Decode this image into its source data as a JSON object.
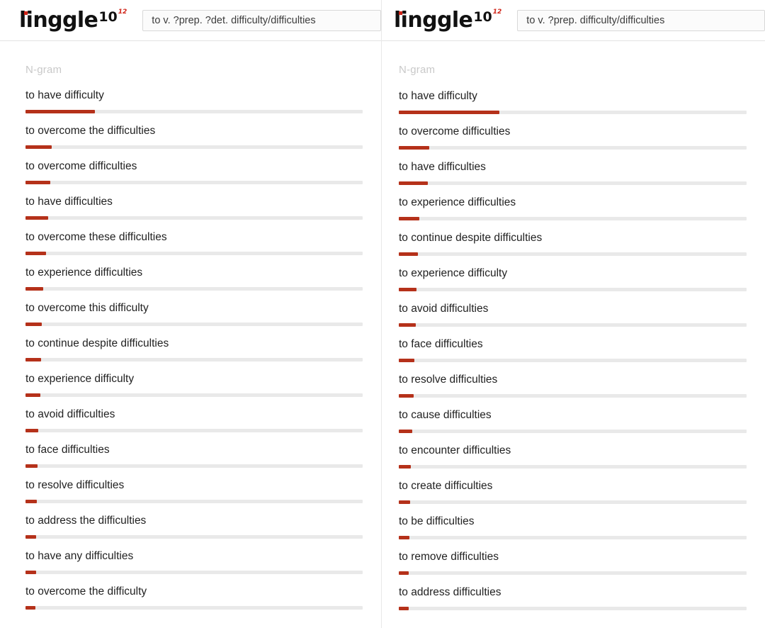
{
  "brand": {
    "word": "linggle",
    "exponent": "10",
    "superscript": "12",
    "dot_color": "#cf2317",
    "bar_color": "#b5311a",
    "track_color": "#e9e9e9"
  },
  "panels": [
    {
      "name": "left",
      "query": "to v. ?prep. ?det. difficulty/difficulties",
      "column_header": "N-gram",
      "chart_data": {
        "type": "bar",
        "title": "N-gram",
        "xlabel": "",
        "ylabel": "",
        "orientation": "horizontal",
        "grid": false,
        "legend": false,
        "xlim": [
          0,
          100
        ],
        "categories": [
          "to have difficulty",
          "to overcome the difficulties",
          "to overcome difficulties",
          "to have difficulties",
          "to overcome these difficulties",
          "to experience difficulties",
          "to overcome this difficulty",
          "to continue despite difficulties",
          "to experience difficulty",
          "to avoid difficulties",
          "to face difficulties",
          "to resolve difficulties",
          "to address the difficulties",
          "to have any difficulties",
          "to overcome the difficulty"
        ],
        "values": [
          20.5,
          7.8,
          7.3,
          6.7,
          6.1,
          5.2,
          4.8,
          4.6,
          4.4,
          3.8,
          3.6,
          3.4,
          3.2,
          3.1,
          2.9
        ]
      },
      "rows": [
        {
          "label": "to have difficulty",
          "pct": 20.5
        },
        {
          "label": "to overcome the difficulties",
          "pct": 7.8
        },
        {
          "label": "to overcome difficulties",
          "pct": 7.3
        },
        {
          "label": "to have difficulties",
          "pct": 6.7
        },
        {
          "label": "to overcome these difficulties",
          "pct": 6.1
        },
        {
          "label": "to experience difficulties",
          "pct": 5.2
        },
        {
          "label": "to overcome this difficulty",
          "pct": 4.8
        },
        {
          "label": "to continue despite difficulties",
          "pct": 4.6
        },
        {
          "label": "to experience difficulty",
          "pct": 4.4
        },
        {
          "label": "to avoid difficulties",
          "pct": 3.8
        },
        {
          "label": "to face difficulties",
          "pct": 3.6
        },
        {
          "label": "to resolve difficulties",
          "pct": 3.4
        },
        {
          "label": "to address the difficulties",
          "pct": 3.2
        },
        {
          "label": "to have any difficulties",
          "pct": 3.1
        },
        {
          "label": "to overcome the difficulty",
          "pct": 2.9
        }
      ]
    },
    {
      "name": "right",
      "query": "to v. ?prep. difficulty/difficulties",
      "column_header": "N-gram",
      "chart_data": {
        "type": "bar",
        "title": "N-gram",
        "xlabel": "",
        "ylabel": "",
        "orientation": "horizontal",
        "grid": false,
        "legend": false,
        "xlim": [
          0,
          100
        ],
        "categories": [
          "to have difficulty",
          "to overcome difficulties",
          "to have difficulties",
          "to experience difficulties",
          "to continue despite difficulties",
          "to experience difficulty",
          "to avoid difficulties",
          "to face difficulties",
          "to resolve difficulties",
          "to cause difficulties",
          "to encounter difficulties",
          "to create difficulties",
          "to be difficulties",
          "to remove difficulties",
          "to address difficulties"
        ],
        "values": [
          29.0,
          8.8,
          8.4,
          6.0,
          5.4,
          5.0,
          4.8,
          4.5,
          4.2,
          3.8,
          3.5,
          3.2,
          3.0,
          2.9,
          2.8
        ]
      },
      "rows": [
        {
          "label": "to have difficulty",
          "pct": 29.0
        },
        {
          "label": "to overcome difficulties",
          "pct": 8.8
        },
        {
          "label": "to have difficulties",
          "pct": 8.4
        },
        {
          "label": "to experience difficulties",
          "pct": 6.0
        },
        {
          "label": "to continue despite difficulties",
          "pct": 5.4
        },
        {
          "label": "to experience difficulty",
          "pct": 5.0
        },
        {
          "label": "to avoid difficulties",
          "pct": 4.8
        },
        {
          "label": "to face difficulties",
          "pct": 4.5
        },
        {
          "label": "to resolve difficulties",
          "pct": 4.2
        },
        {
          "label": "to cause difficulties",
          "pct": 3.8
        },
        {
          "label": "to encounter difficulties",
          "pct": 3.5
        },
        {
          "label": "to create difficulties",
          "pct": 3.2
        },
        {
          "label": "to be difficulties",
          "pct": 3.0
        },
        {
          "label": "to remove difficulties",
          "pct": 2.9
        },
        {
          "label": "to address difficulties",
          "pct": 2.8
        }
      ]
    }
  ]
}
